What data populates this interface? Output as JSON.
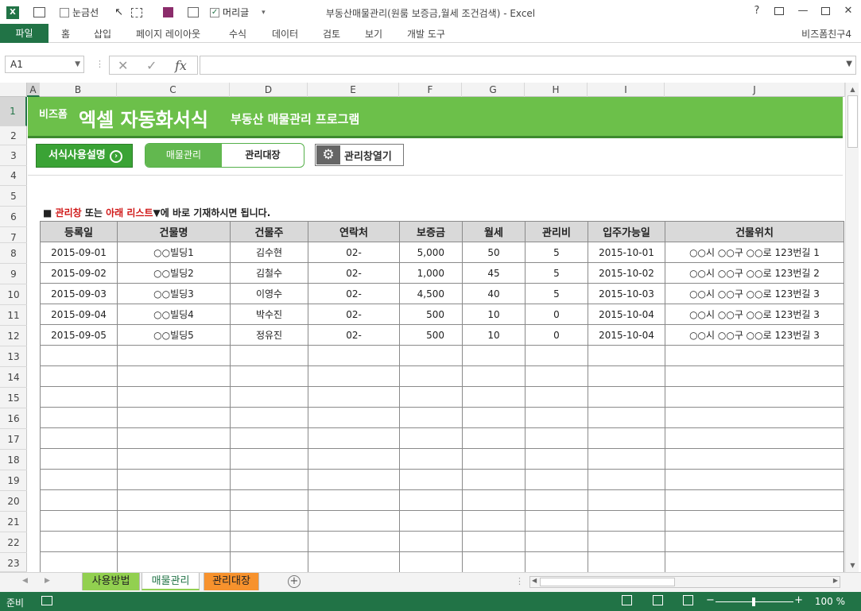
{
  "window": {
    "title": "부동산매물관리(원룸 보증금,월세 조건검색) - Excel",
    "help_icon": "?",
    "qa_gridlines": "눈금선",
    "qa_headers": "머리글",
    "account": "비즈폼친구4"
  },
  "ribbon": {
    "file": "파일",
    "tabs": [
      "홈",
      "삽입",
      "페이지 레이아웃",
      "수식",
      "데이터",
      "검토",
      "보기",
      "개발 도구"
    ]
  },
  "formula_bar": {
    "name_box": "A1",
    "fx": "fx",
    "value": ""
  },
  "columns": [
    "A",
    "B",
    "C",
    "D",
    "E",
    "F",
    "G",
    "H",
    "I",
    "J"
  ],
  "rows": [
    "1",
    "2",
    "3",
    "4",
    "5",
    "6",
    "7",
    "8",
    "9",
    "10",
    "11",
    "12",
    "13",
    "14",
    "15",
    "16",
    "17",
    "18",
    "19",
    "20",
    "21",
    "22",
    "23"
  ],
  "banner": {
    "logo_small": "비즈폼",
    "logo_big": "엑셀 자동화서식",
    "subtitle": "부동산 매물관리 프로그램"
  },
  "buttons": {
    "guide": "서식사용설명",
    "toggle_active": "매물관리",
    "toggle_inactive": "관리대장",
    "open_window": "관리창열기"
  },
  "notice": {
    "prefix": "■",
    "red1": "관리창",
    "mid": "또는",
    "red2": "아래 리스트",
    "suffix": "▼에 바로 기재하시면 됩니다."
  },
  "table": {
    "headers": [
      "등록일",
      "건물명",
      "건물주",
      "연락처",
      "보증금",
      "월세",
      "관리비",
      "입주가능일",
      "건물위치"
    ],
    "rows": [
      [
        "2015-09-01",
        "○○빌딩1",
        "김수현",
        "02-",
        "5,000",
        "50",
        "5",
        "2015-10-01",
        "○○시 ○○구 ○○로 123번길 1"
      ],
      [
        "2015-09-02",
        "○○빌딩2",
        "김철수",
        "02-",
        "1,000",
        "45",
        "5",
        "2015-10-02",
        "○○시 ○○구 ○○로 123번길 2"
      ],
      [
        "2015-09-03",
        "○○빌딩3",
        "이영수",
        "02-",
        "4,500",
        "40",
        "5",
        "2015-10-03",
        "○○시 ○○구 ○○로 123번길 3"
      ],
      [
        "2015-09-04",
        "○○빌딩4",
        "박수진",
        "02-",
        "500",
        "10",
        "0",
        "2015-10-04",
        "○○시 ○○구 ○○로 123번길 3"
      ],
      [
        "2015-09-05",
        "○○빌딩5",
        "정유진",
        "02-",
        "500",
        "10",
        "0",
        "2015-10-04",
        "○○시 ○○구 ○○로 123번길 3"
      ]
    ],
    "empty_rows": 11
  },
  "sheet_tabs": [
    {
      "label": "사용방법",
      "color": "#92d050"
    },
    {
      "label": "매물관리",
      "color": "#ffffff"
    },
    {
      "label": "관리대장",
      "color": "#f7922d"
    }
  ],
  "status": {
    "ready": "준비",
    "zoom": "100 %",
    "zoom_value": 100
  },
  "colors": {
    "excel_green": "#217346",
    "banner_green": "#6cc04a",
    "header_gray": "#d9d9d9",
    "notice_red": "#d01818"
  }
}
